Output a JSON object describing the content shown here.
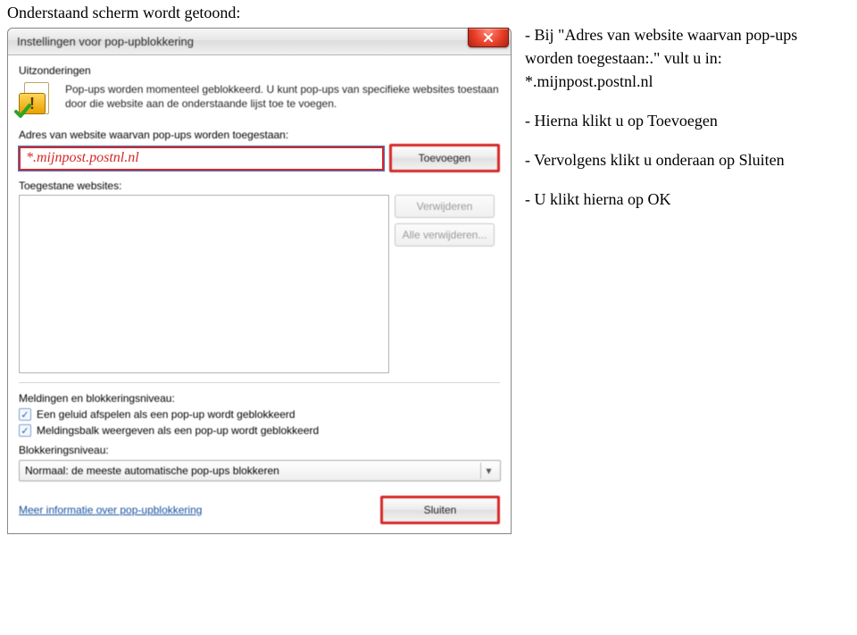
{
  "heading": "Onderstaand scherm wordt getoond:",
  "dialog": {
    "title": "Instellingen voor pop-upblokkering",
    "exceptions_label": "Uitzonderingen",
    "info_text": "Pop-ups worden momenteel geblokkeerd. U kunt pop-ups van specifieke websites toestaan door die website aan de onderstaande lijst toe te voegen.",
    "address_label": "Adres van website waarvan pop-ups worden toegestaan:",
    "address_value": "*.mijnpost.postnl.nl",
    "add_button": "Toevoegen",
    "allowed_label": "Toegestane websites:",
    "remove_button": "Verwijderen",
    "remove_all_button": "Alle verwijderen...",
    "notif_level_label": "Meldingen en blokkeringsniveau:",
    "checkbox_sound": "Een geluid afspelen als een pop-up wordt geblokkeerd",
    "checkbox_bar": "Meldingsbalk weergeven als een pop-up wordt geblokkeerd",
    "block_level_label": "Blokkeringsniveau:",
    "block_level_value": "Normaal: de meeste automatische pop-ups blokkeren",
    "more_info_link": "Meer informatie over pop-upblokkering",
    "close_button": "Sluiten"
  },
  "instructions": {
    "line1": "- Bij \"Adres van website waarvan pop-ups worden toegestaan:.\" vult u in: *.mijnpost.postnl.nl",
    "line2": "- Hierna klikt u op Toevoegen",
    "line3": "- Vervolgens klikt u onderaan op Sluiten",
    "line4": "- U klikt hierna op OK"
  }
}
